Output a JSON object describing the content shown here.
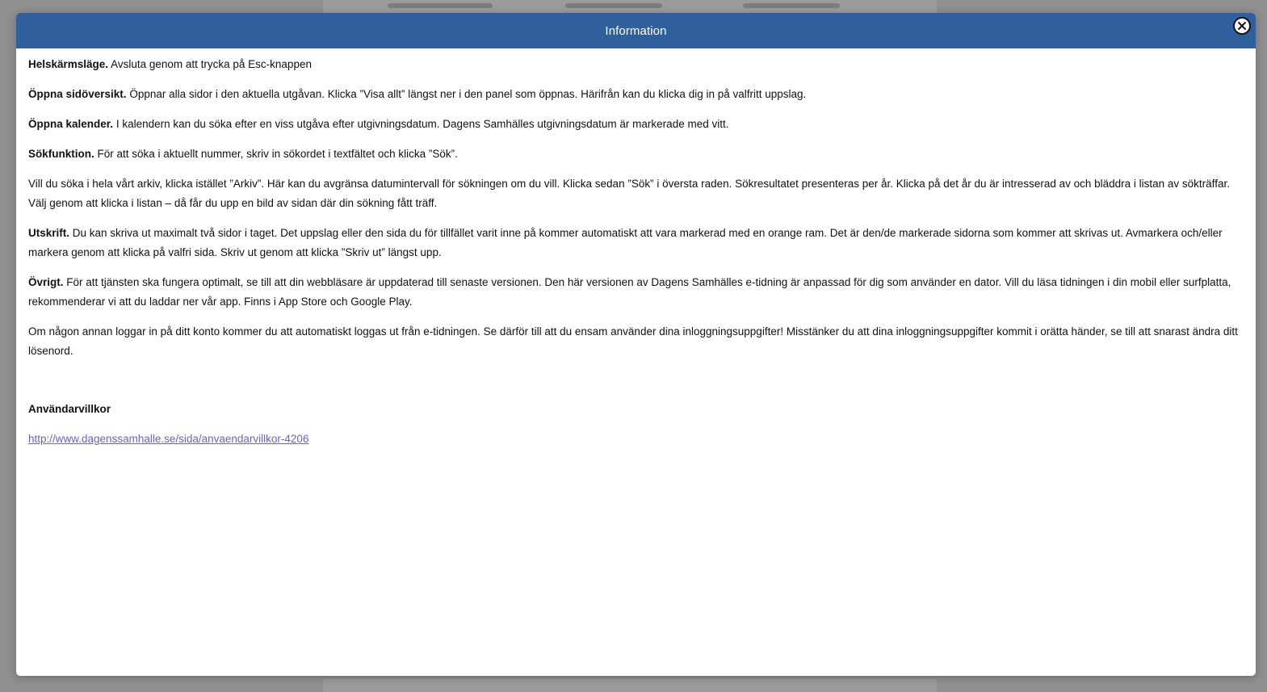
{
  "modal": {
    "title": "Information",
    "close_icon": "close-icon"
  },
  "sections": [
    {
      "label": "Helskärmsläge.",
      "text": "Avsluta genom att trycka på Esc-knappen"
    },
    {
      "label": "Öppna sidöversikt.",
      "text": "Öppnar alla sidor i den aktuella utgåvan. Klicka ”Visa allt” längst ner i den panel som öppnas. Härifrån kan du klicka dig in på valfritt uppslag."
    },
    {
      "label": "Öppna kalender.",
      "text": "I kalendern kan du söka efter en viss utgåva efter utgivningsdatum. Dagens Samhälles utgivningsdatum är markerade med vitt."
    },
    {
      "label": "Sökfunktion.",
      "text": "För att söka i aktuellt nummer, skriv in sökordet i textfältet och klicka ”Sök”."
    },
    {
      "label": "",
      "text": "Vill du söka i hela vårt arkiv, klicka istället ”Arkiv”. Här kan du avgränsa datumintervall för sökningen om du vill. Klicka sedan ”Sök” i översta raden. Sökresultatet presenteras per år. Klicka på det år du är intresserad av och bläddra i listan av sökträffar. Välj genom att klicka i listan – då får du upp en bild av sidan där din sökning fått träff."
    },
    {
      "label": "Utskrift.",
      "text": "Du kan skriva ut maximalt två sidor i taget. Det uppslag eller den sida du för tillfället varit inne på kommer automatiskt att vara markerad med en orange ram. Det är den/de markerade sidorna som kommer att skrivas ut. Avmarkera och/eller markera genom att klicka på valfri sida. Skriv ut genom att klicka ”Skriv ut” längst upp."
    },
    {
      "label": "Övrigt.",
      "text": "För att tjänsten ska fungera optimalt, se till att din webbläsare är uppdaterad till senaste versionen. Den här versionen av Dagens Samhälles e-tidning är anpassad för dig som använder en dator. Vill du läsa tidningen i din mobil eller surfplatta, rekommenderar vi att du laddar ner vår app. Finns i App Store och Google Play."
    },
    {
      "label": "",
      "text": "Om någon annan loggar in på ditt konto kommer du att automatiskt loggas ut från e-tidningen. Se därför till att du ensam använder dina inloggningsuppgifter! Misstänker du att dina inloggningsuppgifter kommit i orätta händer, se till att snarast ändra ditt lösenord."
    }
  ],
  "terms": {
    "title": "Användarvillkor",
    "link_text": "http://www.dagenssamhalle.se/sida/anvaendarvillkor-4206"
  },
  "colors": {
    "header": "#2f5f9c",
    "link": "#6a5fd6",
    "backdrop": "#8f8f8f"
  }
}
